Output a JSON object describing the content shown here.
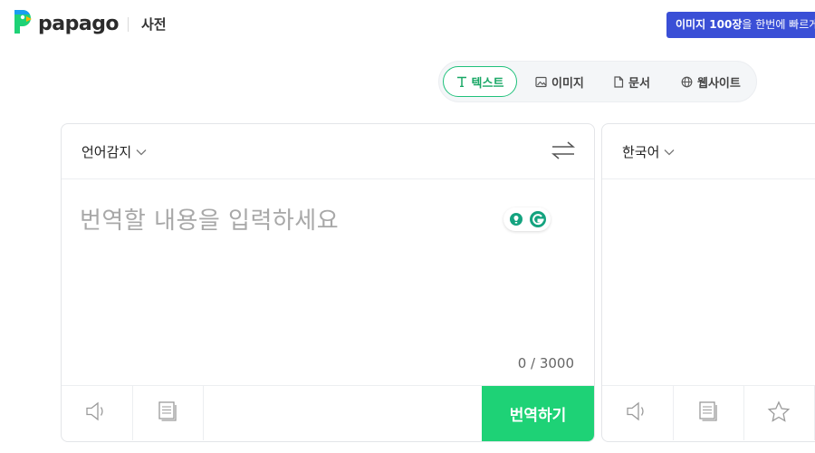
{
  "header": {
    "logo_text": "papago",
    "dict_link": "사전",
    "promo": {
      "bold": "이미지 100장",
      "rest": "을 한번에 빠르게"
    },
    "brand_color": "#1ed276",
    "promo_color": "#3a4fd6"
  },
  "modes": {
    "text": "텍스트",
    "image": "이미지",
    "document": "문서",
    "website": "웹사이트",
    "active": "text"
  },
  "source": {
    "language": "언어감지",
    "placeholder": "번역할 내용을 입력하세요",
    "counter": "0 / 3000",
    "translate_button": "번역하기"
  },
  "target": {
    "language": "한국어"
  },
  "icons": [
    "papago-logo-icon",
    "text-icon",
    "image-icon",
    "document-icon",
    "globe-icon",
    "chevron-down-icon",
    "swap-icon",
    "grammarly-icon",
    "speaker-icon",
    "copy-icon",
    "star-icon"
  ]
}
